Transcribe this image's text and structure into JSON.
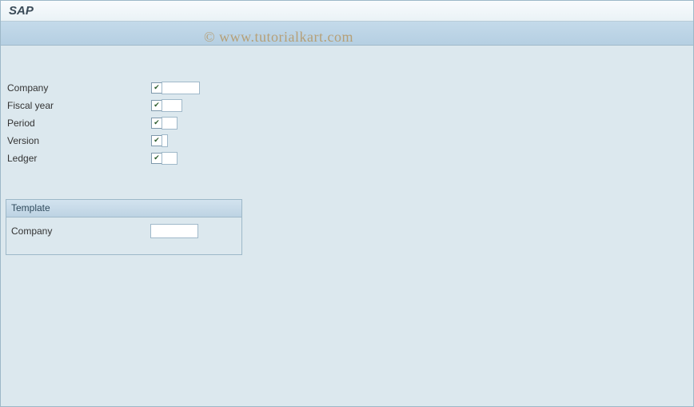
{
  "header": {
    "title": "SAP"
  },
  "fields": {
    "company": {
      "label": "Company",
      "checked": true,
      "value": ""
    },
    "fiscal_year": {
      "label": "Fiscal year",
      "checked": true,
      "value": ""
    },
    "period": {
      "label": "Period",
      "checked": true,
      "value": ""
    },
    "version": {
      "label": "Version",
      "checked": true,
      "value": ""
    },
    "ledger": {
      "label": "Ledger",
      "checked": true,
      "value": ""
    }
  },
  "template_group": {
    "title": "Template",
    "company": {
      "label": "Company",
      "value": ""
    }
  },
  "watermark": "© www.tutorialkart.com"
}
